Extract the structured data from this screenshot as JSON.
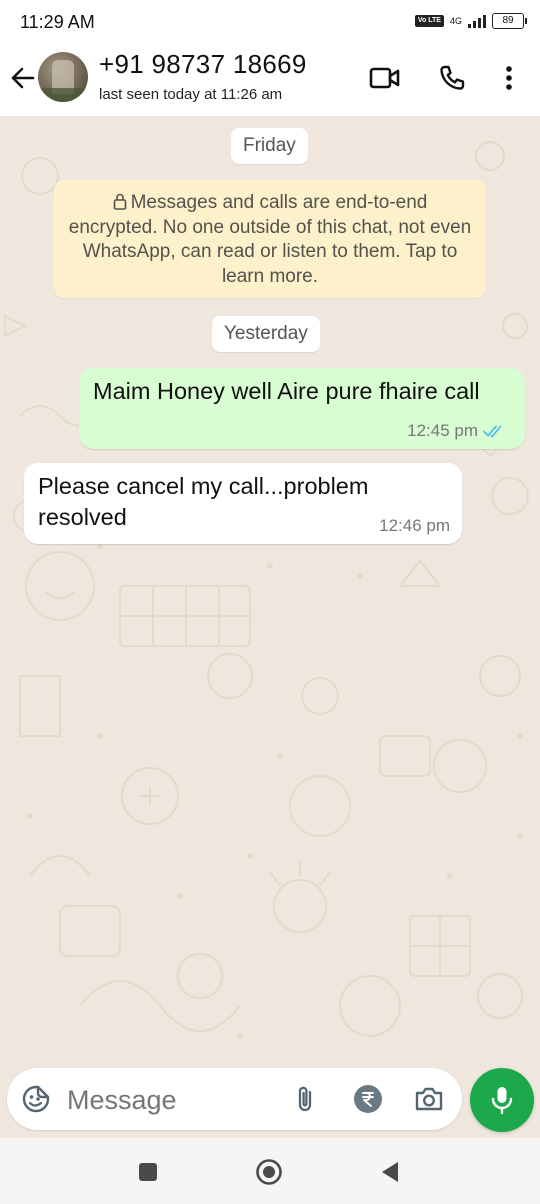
{
  "status_bar": {
    "time": "11:29 AM",
    "volte": "Vo LTE",
    "network": "4G",
    "battery": "89"
  },
  "header": {
    "contact_name": "+91 98737 18669",
    "last_seen": "last seen today at 11:26 am",
    "icons": [
      "back-arrow-icon",
      "video-call-icon",
      "phone-icon",
      "more-vert-icon"
    ]
  },
  "chat": {
    "date_friday": "Friday",
    "encryption_notice": "Messages and calls are end-to-end encrypted. No one outside of this chat, not even WhatsApp, can read or listen to them. Tap to learn more.",
    "date_yesterday": "Yesterday",
    "messages": [
      {
        "direction": "outgoing",
        "text": "Maim Honey well Aire pure fhaire call",
        "time": "12:45 pm",
        "status": "read"
      },
      {
        "direction": "incoming",
        "text": "Please cancel my call...problem resolved",
        "time": "12:46 pm"
      }
    ]
  },
  "composer": {
    "placeholder": "Message",
    "icons": [
      "sticker-icon",
      "attach-icon",
      "rupee-icon",
      "camera-icon",
      "mic-icon"
    ]
  },
  "colors": {
    "outgoing_bubble": "#d9fdd3",
    "incoming_bubble": "#ffffff",
    "notice_bg": "#fdf1cc",
    "chat_bg": "#efe7dd",
    "accent_green": "#1ba94c",
    "read_tick": "#53bdeb"
  }
}
